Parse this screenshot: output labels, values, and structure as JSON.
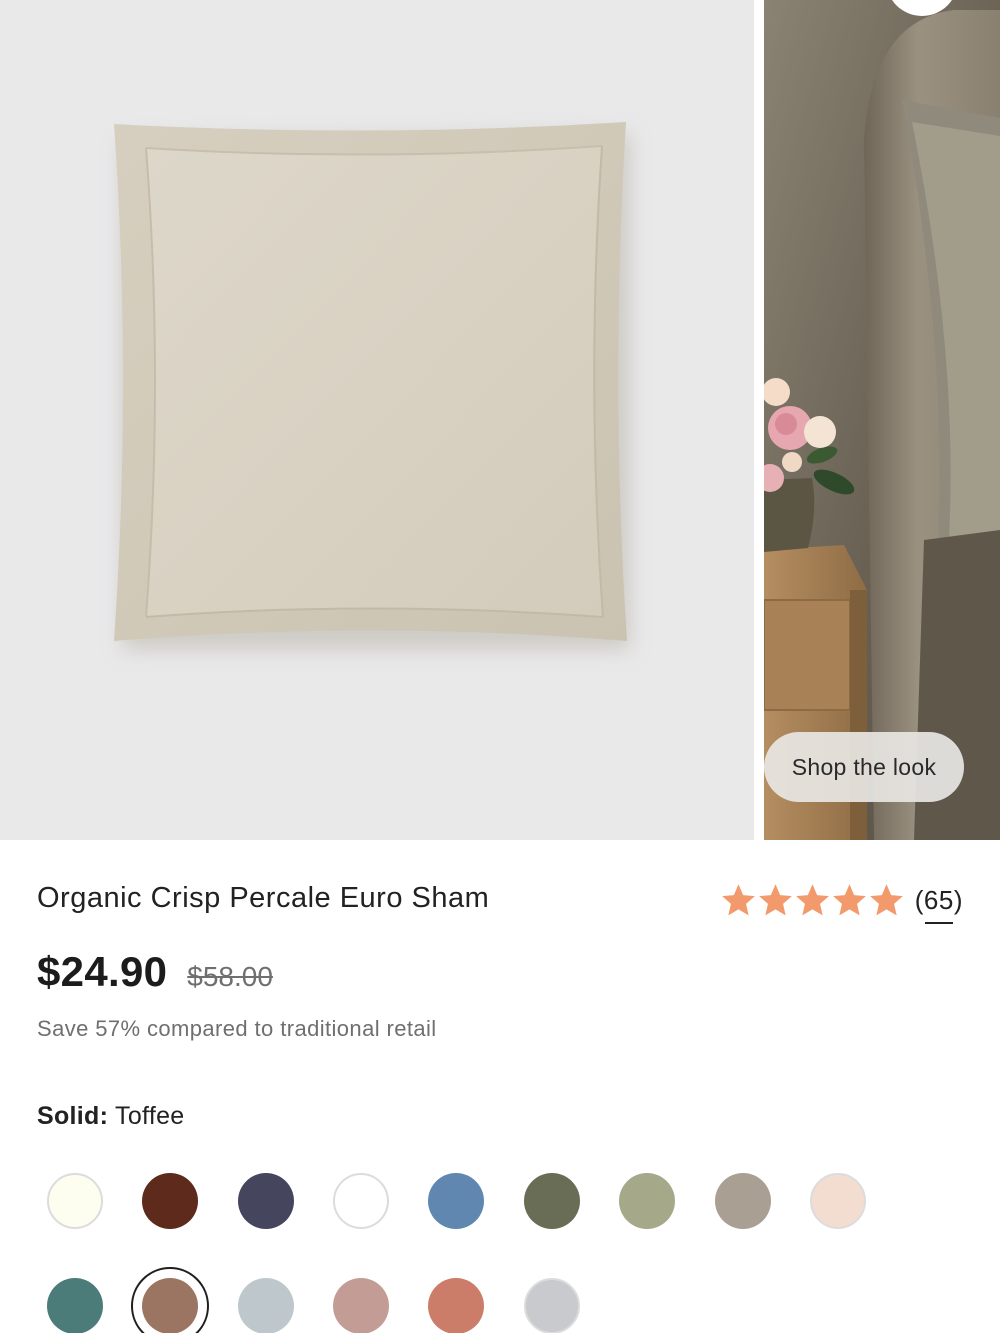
{
  "gallery": {
    "shop_look_label": "Shop the look"
  },
  "product": {
    "title": "Organic Crisp Percale Euro Sham",
    "rating": 5,
    "review_count": "(65)",
    "price": "$24.90",
    "compare_price": "$58.00",
    "savings": "Save 57% compared to traditional retail"
  },
  "color": {
    "type_label": "Solid:",
    "selected_name": "Toffee"
  },
  "colors": {
    "accent_star": "#f29a6b",
    "swatches": [
      "#fdfdf0",
      "#5e2a1c",
      "#45455e",
      "#ffffff",
      "#6087b0",
      "#6a6d55",
      "#a6a88a",
      "#aa9f93",
      "#f3ddd0",
      "#4b7c7a",
      "#9b7561",
      "#bec8cc",
      "#c39c96",
      "#cc7d69",
      "#c9cacd"
    ]
  }
}
